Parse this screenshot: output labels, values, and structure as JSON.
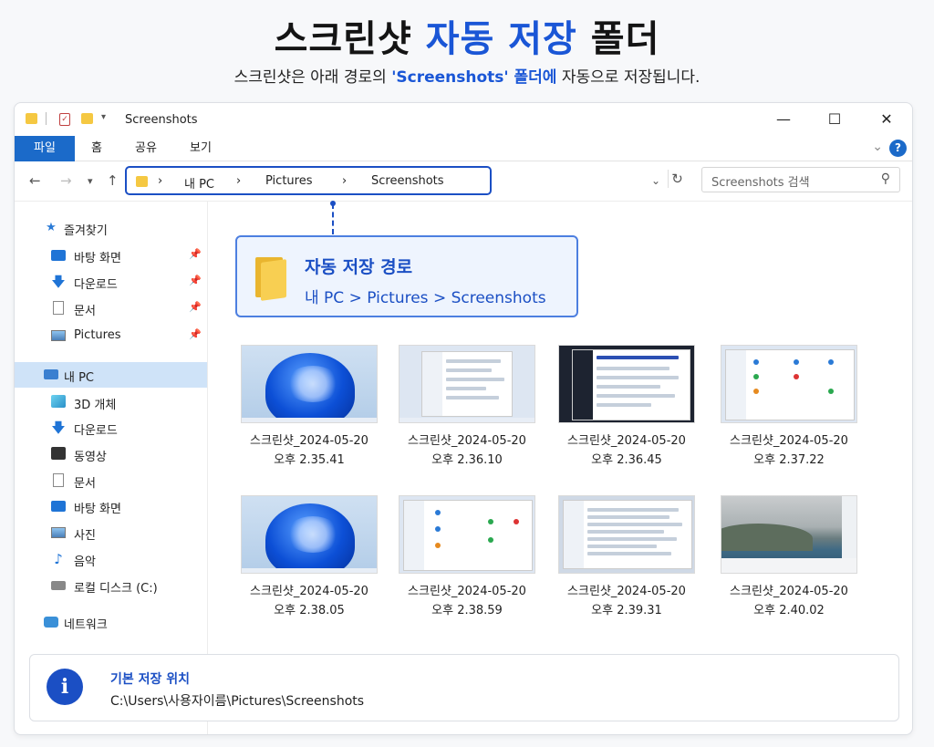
{
  "hero": {
    "title_part1": "스크린샷",
    "title_accent": "자동 저장",
    "title_part2": "폴더",
    "subtitle_part1": "스크린샷은 아래 경로의",
    "subtitle_accent": "'Screenshots' 폴더에",
    "subtitle_part2": "자동으로 저장됩니다."
  },
  "window": {
    "title": "Screenshots",
    "controls": {
      "minimize": "—",
      "maximize": "☐",
      "close": "✕"
    }
  },
  "ribbon": {
    "tabs": [
      "파일",
      "홈",
      "공유",
      "보기"
    ],
    "help": "?"
  },
  "navbar": {
    "breadcrumb": [
      "내 PC",
      "Pictures",
      "Screenshots"
    ],
    "separator": "›",
    "search_placeholder": "Screenshots 검색"
  },
  "sidebar": {
    "items": [
      {
        "label": "즐겨찾기",
        "icon": "star-icon"
      },
      {
        "label": "바탕 화면",
        "icon": "desktop-icon",
        "pinned": true
      },
      {
        "label": "다운로드",
        "icon": "download-icon",
        "pinned": true
      },
      {
        "label": "문서",
        "icon": "document-icon",
        "pinned": true
      },
      {
        "label": "Pictures",
        "icon": "pictures-icon",
        "pinned": true
      },
      {
        "label": "내 PC",
        "icon": "pc-icon",
        "selected": true
      },
      {
        "label": "3D 개체",
        "icon": "cube-icon"
      },
      {
        "label": "다운로드",
        "icon": "download-icon"
      },
      {
        "label": "동영상",
        "icon": "video-icon"
      },
      {
        "label": "문서",
        "icon": "document-icon"
      },
      {
        "label": "바탕 화면",
        "icon": "desktop-icon"
      },
      {
        "label": "사진",
        "icon": "pictures-icon"
      },
      {
        "label": "음악",
        "icon": "music-icon"
      },
      {
        "label": "로컬 디스크 (C:)",
        "icon": "drive-icon"
      },
      {
        "label": "네트워크",
        "icon": "network-icon"
      }
    ]
  },
  "callout": {
    "title": "자동 저장 경로",
    "path": "내 PC > Pictures > Screenshots"
  },
  "files": [
    {
      "name": "스크린샷_2024-05-20",
      "time": "오후 2.35.41",
      "thumb": "bloom"
    },
    {
      "name": "스크린샷_2024-05-20",
      "time": "오후 2.36.10",
      "thumb": "ui-light"
    },
    {
      "name": "스크린샷_2024-05-20",
      "time": "오후 2.36.45",
      "thumb": "ui-dark"
    },
    {
      "name": "스크린샷_2024-05-20",
      "time": "오후 2.37.22",
      "thumb": "ui-grid"
    },
    {
      "name": "스크린샷_2024-05-20",
      "time": "오후 2.38.05",
      "thumb": "bloom"
    },
    {
      "name": "스크린샷_2024-05-20",
      "time": "오후 2.38.59",
      "thumb": "ui-grid"
    },
    {
      "name": "스크린샷_2024-05-20",
      "time": "오후 2.39.31",
      "thumb": "ui-list"
    },
    {
      "name": "스크린샷_2024-05-20",
      "time": "오후 2.40.02",
      "thumb": "lake"
    }
  ],
  "info": {
    "icon": "i",
    "title": "기본 저장 위치",
    "path": "C:\\Users\\사용자이름\\Pictures\\Screenshots"
  },
  "colors": {
    "accent": "#1b4fc4",
    "ribbon_file": "#1b6ac9",
    "selection": "#cfe3f8",
    "folder": "#f5c842"
  }
}
